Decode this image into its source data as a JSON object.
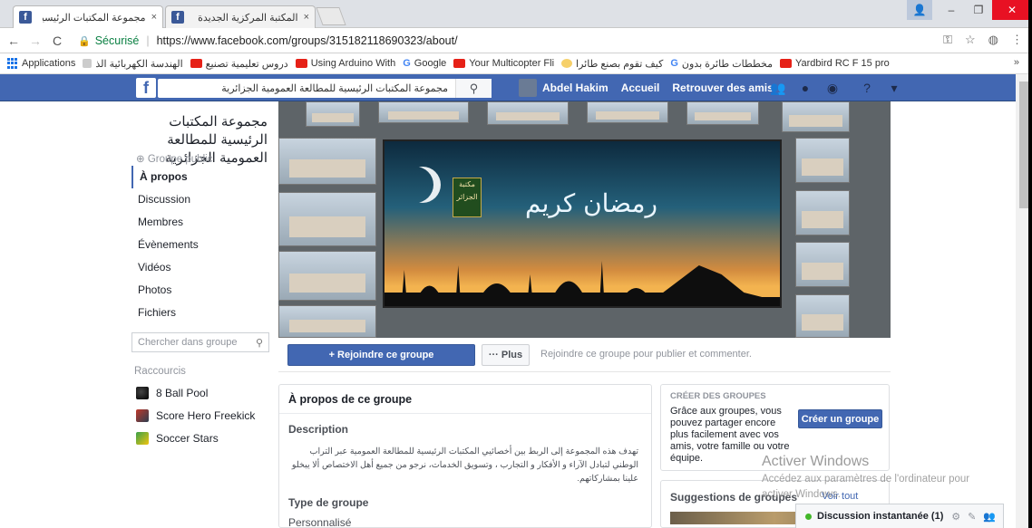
{
  "browser": {
    "tabs": [
      {
        "title": "مجموعة المكتبات الرئيسية",
        "close": "×"
      },
      {
        "title": "المكتبة المركزية الجديدة لا",
        "close": "×"
      }
    ],
    "window_controls": {
      "minimize": "–",
      "maximize": "❐",
      "close": "✕"
    },
    "secure_label": "Sécurisé",
    "url": "https://www.facebook.com/groups/315182118690323/about/",
    "bookmarks": [
      {
        "label": "Applications"
      },
      {
        "label": "الهندسة الكهربائية الذ"
      },
      {
        "label": "دروس تعليمية تصنيع"
      },
      {
        "label": "Using Arduino With"
      },
      {
        "label": "Google"
      },
      {
        "label": "Your Multicopter Fli"
      },
      {
        "label": "كيف تقوم بصنع طائرا"
      },
      {
        "label": "مخططات طائرة بدون"
      },
      {
        "label": "Yardbird RC F 15 pro"
      }
    ],
    "bookmarks_more": "»"
  },
  "fb": {
    "logo": "f",
    "search_value": "مجموعة المكتبات الرئيسية للمطالعة العمومية الجزائرية",
    "user": "Abdel Hakim",
    "nav": [
      "Accueil",
      "Retrouver des amis"
    ]
  },
  "group": {
    "title": "مجموعة المكتبات الرئيسية للمطالعة العمومية الجزائرية",
    "type": "⊕ Groupe public",
    "nav": [
      "À propos",
      "Discussion",
      "Membres",
      "Évènements",
      "Vidéos",
      "Photos",
      "Fichiers"
    ],
    "search_placeholder": "Chercher dans groupe",
    "shortcuts_label": "Raccourcis",
    "shortcuts": [
      "8 Ball Pool",
      "Score Hero Freekick",
      "Soccer Stars"
    ]
  },
  "cover": {
    "calligraphy": "رمضان كريم",
    "emblem": "مكتبة الجزائر"
  },
  "join": {
    "join_label": "+ Rejoindre ce groupe",
    "more_label": "··· Plus",
    "hint": "Rejoindre ce groupe pour publier et commenter."
  },
  "about": {
    "heading": "À propos de ce groupe",
    "description_label": "Description",
    "description": "تهدف هذه المجموعة إلى الربط بين أخصائيي المكتبات الرئيسية للمطالعة العمومية عبر التراب الوطني لتبادل الآراء و الأفكار و التجارب ، وتسويق الخدمات، نرجو من جميع أهل الاختصاص ألا يبخلو علينا بمشاركاتهم.",
    "type_label": "Type de groupe",
    "type_value": "Personnalisé"
  },
  "create": {
    "heading": "CRÉER DES GROUPES",
    "text": "Grâce aux groupes, vous pouvez partager encore plus facilement avec vos amis, votre famille ou votre équipe.",
    "button": "Créer un groupe"
  },
  "suggestions": {
    "heading": "Suggestions de groupes",
    "link": "Voir tout"
  },
  "watermark": {
    "line1": "Activer Windows",
    "line2": "Accédez aux paramètres de l'ordinateur pour activer Windows."
  },
  "chat": {
    "label": "Discussion instantanée (1)"
  }
}
